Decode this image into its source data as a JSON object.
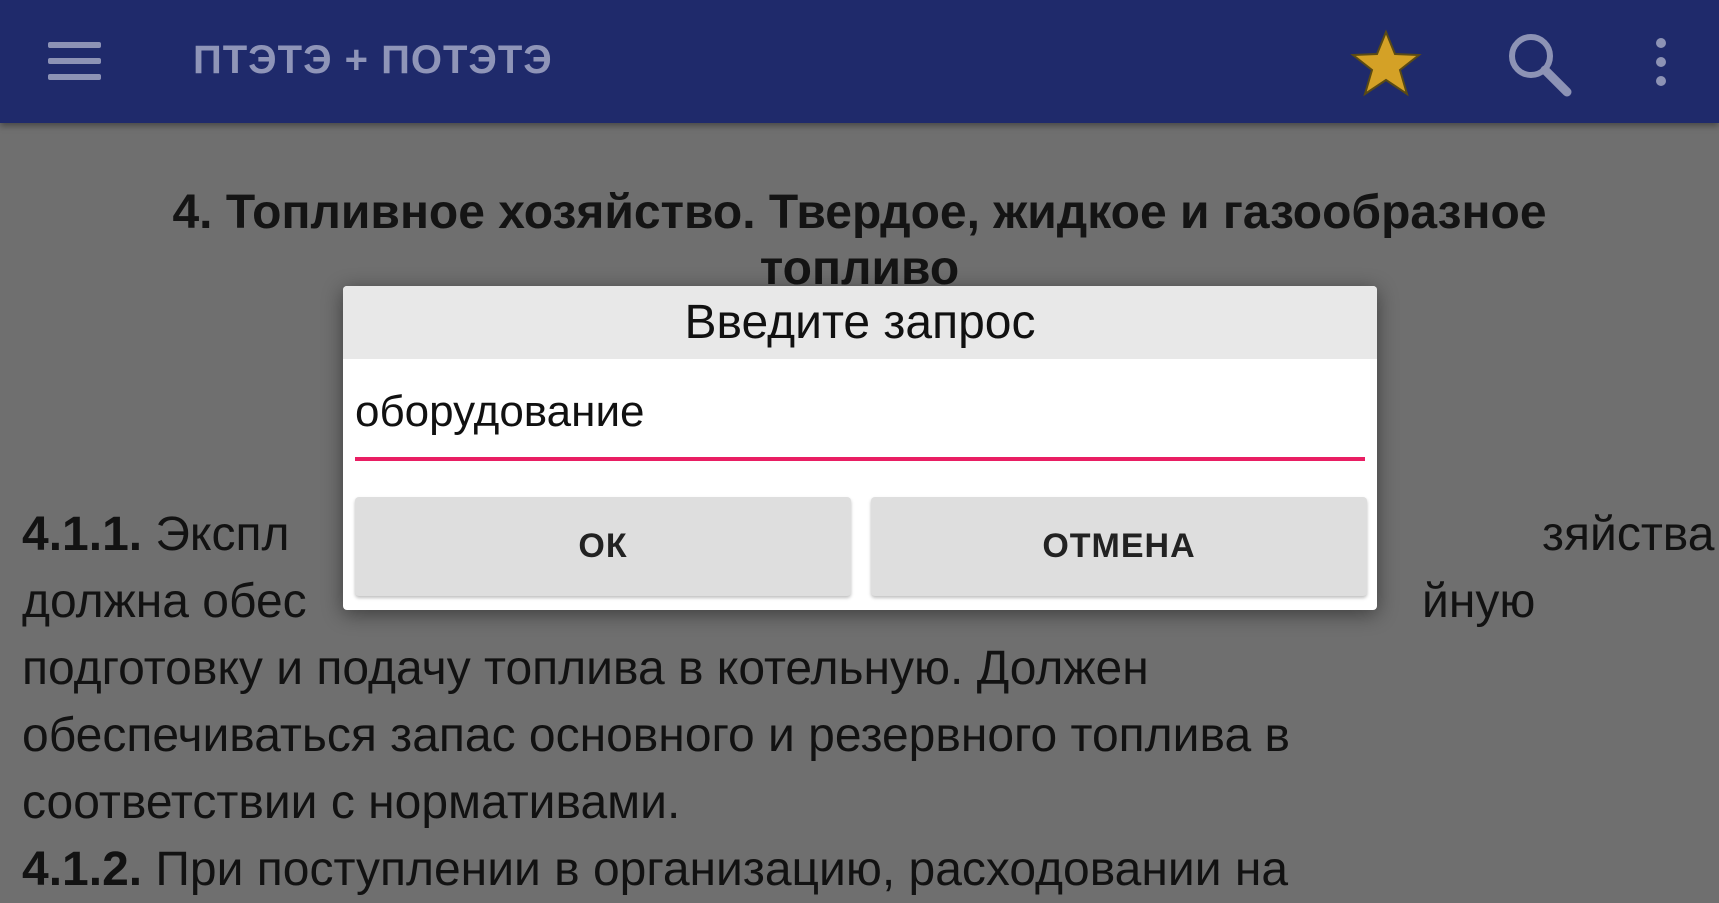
{
  "appbar": {
    "title": "ПТЭТЭ + ПОТЭТЭ",
    "icons": [
      "menu-icon",
      "star-icon",
      "search-icon",
      "more-vert-icon"
    ],
    "colors": {
      "bar": "#1f2a6b",
      "star": "#d4a126"
    }
  },
  "content": {
    "heading_line1": "4. Топливное хозяйство. Твердое, жидкое и газообразное",
    "heading_line2": "топливо",
    "paragraphs": [
      {
        "num": "4.1.1.",
        "text": " Экспл",
        "tail": "зяйства"
      },
      {
        "text": "должна обес",
        "tail": "йную"
      },
      {
        "text": "подготовку и подачу топлива в котельную. Должен"
      },
      {
        "text": "обеспечиваться запас основного и резервного топлива в"
      },
      {
        "text": "соответствии с нормативами."
      },
      {
        "num": "4.1.2.",
        "text": " При поступлении в организацию, расходовании на"
      }
    ]
  },
  "dialog": {
    "title": "Введите запрос",
    "input_value": "оборудование",
    "ok_label": "ОК",
    "cancel_label": "ОТМЕНА",
    "accent": "#e91e63"
  }
}
